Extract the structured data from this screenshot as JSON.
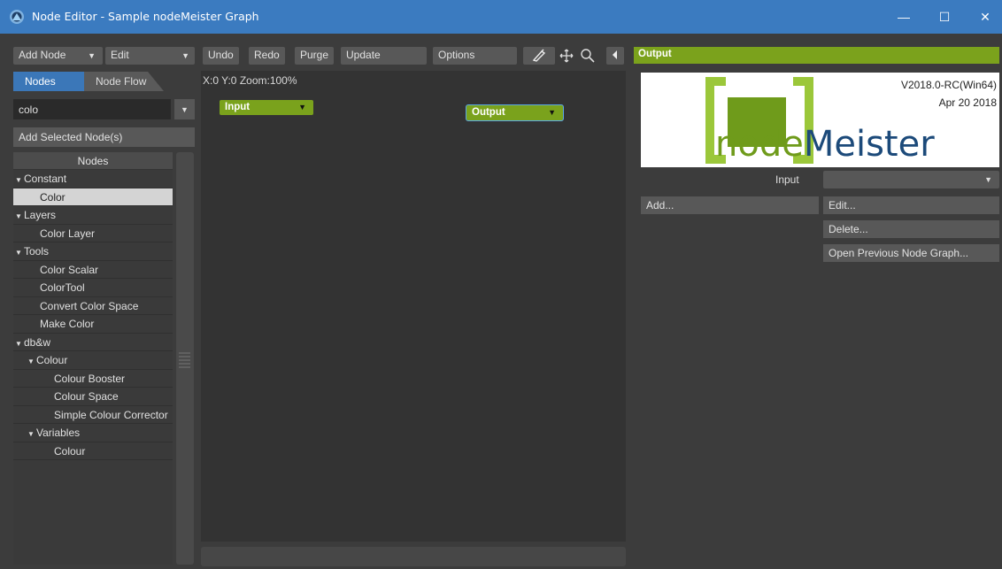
{
  "window": {
    "title": "Node Editor - Sample nodeMeister Graph",
    "minimize_glyph": "—",
    "maximize_glyph": "☐",
    "close_glyph": "✕"
  },
  "toolbar": {
    "add_node": "Add Node",
    "edit": "Edit",
    "undo": "Undo",
    "redo": "Redo",
    "purge": "Purge",
    "update": "Update",
    "options": "Options"
  },
  "left_panel": {
    "tabs": [
      "Nodes",
      "Node Flow"
    ],
    "search_value": "colo",
    "add_selected": "Add Selected Node(s)",
    "tree_header": "Nodes",
    "tree": [
      {
        "label": "Constant",
        "type": "group",
        "depth": 0
      },
      {
        "label": "Color",
        "type": "item",
        "depth": 1,
        "selected": true
      },
      {
        "label": "Layers",
        "type": "group",
        "depth": 0
      },
      {
        "label": "Color Layer",
        "type": "item",
        "depth": 1
      },
      {
        "label": "Tools",
        "type": "group",
        "depth": 0
      },
      {
        "label": "Color Scalar",
        "type": "item",
        "depth": 1
      },
      {
        "label": "ColorTool",
        "type": "item",
        "depth": 1
      },
      {
        "label": "Convert Color Space",
        "type": "item",
        "depth": 1
      },
      {
        "label": "Make Color",
        "type": "item",
        "depth": 1
      },
      {
        "label": "db&w",
        "type": "group",
        "depth": 0
      },
      {
        "label": "Colour",
        "type": "group",
        "depth": 1
      },
      {
        "label": "Colour Booster",
        "type": "item",
        "depth": 2
      },
      {
        "label": "Colour Space",
        "type": "item",
        "depth": 2
      },
      {
        "label": "Simple Colour Corrector",
        "type": "item",
        "depth": 2
      },
      {
        "label": "Variables",
        "type": "group",
        "depth": 1
      },
      {
        "label": "Colour",
        "type": "item",
        "depth": 2
      }
    ]
  },
  "canvas": {
    "status": "X:0 Y:0 Zoom:100%",
    "nodes": [
      "Input",
      "Output"
    ]
  },
  "right_panel": {
    "header": "Output",
    "version": "V2018.0-RC(Win64)",
    "date": "Apr 20 2018",
    "logo_text_node": "node",
    "logo_text_meister": "Meister",
    "input_label": "Input",
    "input_value": "",
    "add": "Add...",
    "edit": "Edit...",
    "delete": "Delete...",
    "open_previous": "Open Previous Node Graph..."
  },
  "colors": {
    "titlebar": "#3b7bc0",
    "node_green": "#7aa21c",
    "tab_blue": "#3b77b8",
    "selected_row": "#d4d4d4"
  }
}
